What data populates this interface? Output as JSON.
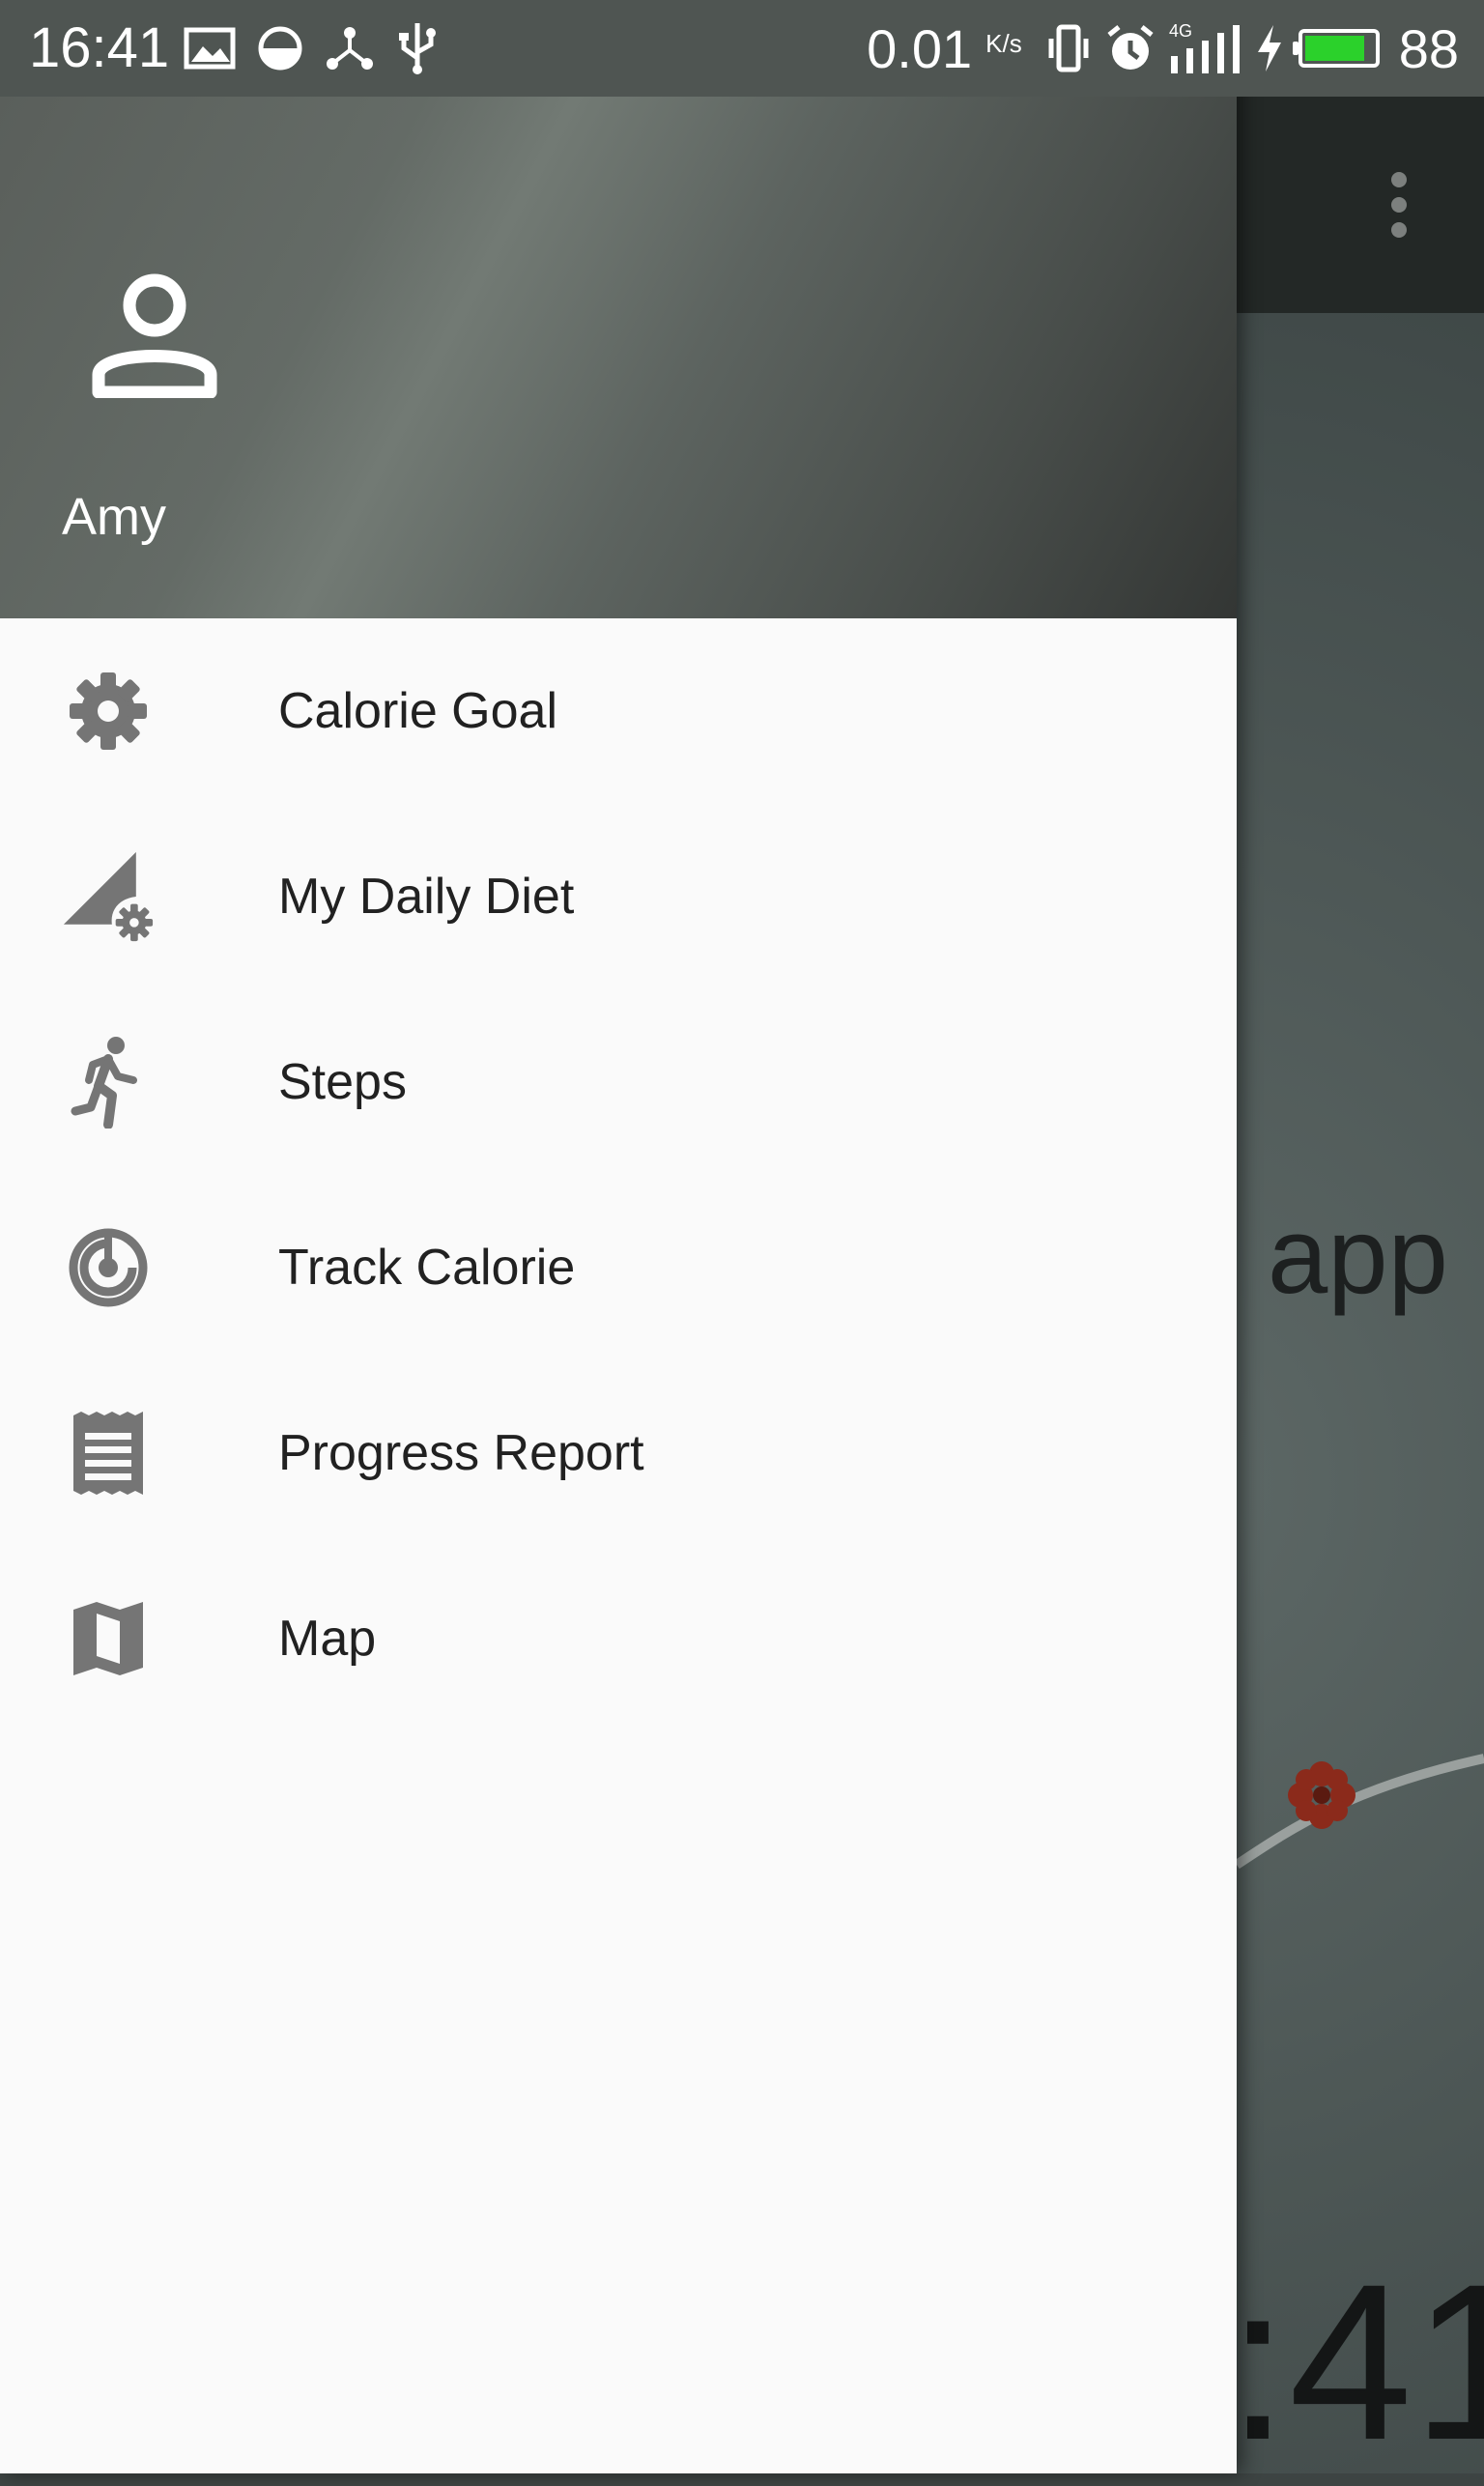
{
  "status_bar": {
    "time": "16:41",
    "left_icons": [
      "image-icon",
      "half-circle-icon",
      "share-nodes-icon",
      "usb-icon"
    ],
    "net_speed": "0.01",
    "net_speed_unit": "K/s",
    "right_icons": [
      "vibrate-icon",
      "alarm-icon",
      "signal-4g-icon",
      "charging-icon",
      "battery-icon"
    ],
    "network_type": "4G",
    "battery_level": "88",
    "battery_color": "#2bd12b"
  },
  "drawer": {
    "header": {
      "avatar_icon": "person-icon",
      "user_name": "Amy"
    },
    "items": [
      {
        "label": "Calorie Goal",
        "icon": "gear-icon"
      },
      {
        "label": "My Daily Diet",
        "icon": "signal-settings-icon"
      },
      {
        "label": "Steps",
        "icon": "running-icon"
      },
      {
        "label": "Track Calorie",
        "icon": "target-icon"
      },
      {
        "label": "Progress Report",
        "icon": "receipt-icon"
      },
      {
        "label": "Map",
        "icon": "map-icon"
      }
    ]
  },
  "background_app": {
    "visible_text_fragment": "app",
    "visible_time_fragment": ":41",
    "overflow_icon": "more-vert-icon"
  },
  "colors": {
    "drawer_background": "#fafafa",
    "icon_gray": "#757575",
    "label_text": "#212121",
    "status_bar": "#4f5552"
  }
}
